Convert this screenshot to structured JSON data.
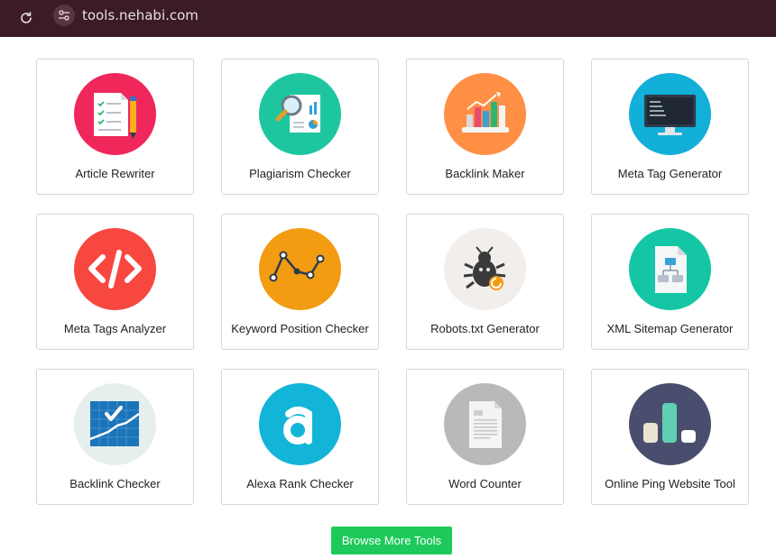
{
  "browser": {
    "url": "tools.nehabi.com"
  },
  "tools": [
    {
      "label": "Article Rewriter",
      "icon": "article-rewriter-icon",
      "color": "#f0275a"
    },
    {
      "label": "Plagiarism Checker",
      "icon": "plagiarism-checker-icon",
      "color": "#1ec6a0"
    },
    {
      "label": "Backlink Maker",
      "icon": "backlink-maker-icon",
      "color": "#ff8f44"
    },
    {
      "label": "Meta Tag Generator",
      "icon": "meta-tag-generator-icon",
      "color": "#12afd8"
    },
    {
      "label": "Meta Tags Analyzer",
      "icon": "meta-tags-analyzer-icon",
      "color": "#f7473f"
    },
    {
      "label": "Keyword Position Checker",
      "icon": "keyword-position-checker-icon",
      "color": "#f39c12"
    },
    {
      "label": "Robots.txt Generator",
      "icon": "robots-txt-generator-icon",
      "color": "#f1eeec"
    },
    {
      "label": "XML Sitemap Generator",
      "icon": "xml-sitemap-generator-icon",
      "color": "#14c6a4"
    },
    {
      "label": "Backlink Checker",
      "icon": "backlink-checker-icon",
      "color": "#e6eeee"
    },
    {
      "label": "Alexa Rank Checker",
      "icon": "alexa-rank-checker-icon",
      "color": "#12b5d8"
    },
    {
      "label": "Word Counter",
      "icon": "word-counter-icon",
      "color": "#b9b9b9"
    },
    {
      "label": "Online Ping Website Tool",
      "icon": "online-ping-website-tool-icon",
      "color": "#4a4e6e"
    }
  ],
  "browse_button": {
    "label": "Browse More Tools",
    "color": "#1dc95a"
  }
}
